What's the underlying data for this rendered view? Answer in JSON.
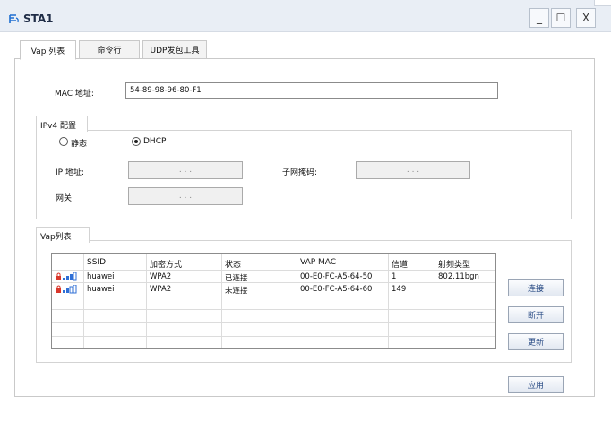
{
  "window": {
    "title": "STA1",
    "minimize": "_",
    "maximize": "☐",
    "close": "X"
  },
  "tabs": [
    {
      "label": "Vap 列表",
      "active": true
    },
    {
      "label": "命令行",
      "active": false
    },
    {
      "label": "UDP发包工具",
      "active": false
    }
  ],
  "mac": {
    "label": "MAC 地址:",
    "value": "54-89-98-96-80-F1"
  },
  "ipv4": {
    "legend": "IPv4 配置",
    "static_label": "静态",
    "dhcp_label": "DHCP",
    "mode": "DHCP",
    "ip_label": "IP 地址:",
    "mask_label": "子网掩码:",
    "gateway_label": "网关:",
    "ip_value": ".   .   .",
    "mask_value": ".   .   .",
    "gateway_value": ".   .   ."
  },
  "vap": {
    "legend": "Vap列表",
    "columns": [
      "SSID",
      "加密方式",
      "状态",
      "VAP MAC",
      "信道",
      "射频类型"
    ],
    "rows": [
      {
        "ssid": "huawei",
        "enc": "WPA2",
        "status": "已连接",
        "mac": "00-E0-FC-A5-64-50",
        "channel": "1",
        "radio": "802.11bgn"
      },
      {
        "ssid": "huawei",
        "enc": "WPA2",
        "status": "未连接",
        "mac": "00-E0-FC-A5-64-60",
        "channel": "149",
        "radio": ""
      }
    ]
  },
  "buttons": {
    "connect": "连接",
    "disconnect": "断开",
    "refresh": "更新",
    "apply": "应用"
  },
  "colors": {
    "titlebar": "#e9eef5",
    "accent": "#2b4d86",
    "lock": "#d9372b",
    "signal": "#2f6fd6"
  }
}
